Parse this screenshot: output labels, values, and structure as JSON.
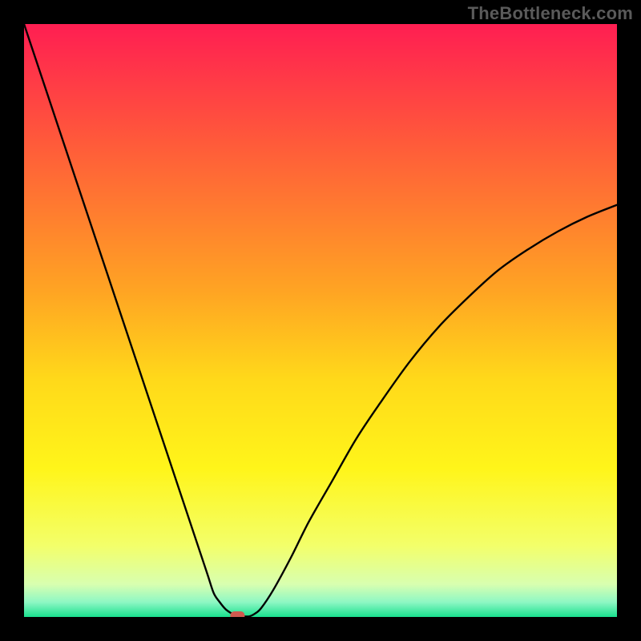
{
  "watermark": "TheBottleneck.com",
  "chart_data": {
    "type": "line",
    "title": "",
    "xlabel": "",
    "ylabel": "",
    "xlim": [
      0,
      100
    ],
    "ylim": [
      0,
      100
    ],
    "grid": false,
    "legend": false,
    "background_gradient": {
      "stops": [
        {
          "pos": 0.0,
          "color": "#ff1e52"
        },
        {
          "pos": 0.2,
          "color": "#ff5a3a"
        },
        {
          "pos": 0.45,
          "color": "#ffa423"
        },
        {
          "pos": 0.6,
          "color": "#ffd91a"
        },
        {
          "pos": 0.75,
          "color": "#fff51a"
        },
        {
          "pos": 0.88,
          "color": "#f3ff6a"
        },
        {
          "pos": 0.945,
          "color": "#d8ffb0"
        },
        {
          "pos": 0.975,
          "color": "#8ef7c4"
        },
        {
          "pos": 1.0,
          "color": "#19e08e"
        }
      ]
    },
    "marker": {
      "x": 36.0,
      "y": 0.0,
      "color": "#cf5a4f"
    },
    "series": [
      {
        "name": "curve",
        "color": "#000000",
        "x": [
          0,
          2,
          4,
          6,
          8,
          10,
          12,
          14,
          16,
          18,
          20,
          22,
          24,
          26,
          28,
          30,
          31,
          32,
          33,
          34,
          35,
          36,
          37,
          38,
          39,
          40,
          42,
          45,
          48,
          52,
          56,
          60,
          65,
          70,
          75,
          80,
          85,
          90,
          95,
          100
        ],
        "values": [
          100,
          94,
          88,
          82,
          76,
          70,
          64,
          58,
          52,
          46,
          40,
          34,
          28,
          22,
          16,
          10,
          7,
          4,
          2.5,
          1.3,
          0.6,
          0.1,
          0.1,
          0.1,
          0.6,
          1.5,
          4.5,
          10,
          16,
          23,
          30,
          36,
          43,
          49,
          54,
          58.5,
          62,
          65,
          67.5,
          69.5
        ]
      }
    ]
  }
}
